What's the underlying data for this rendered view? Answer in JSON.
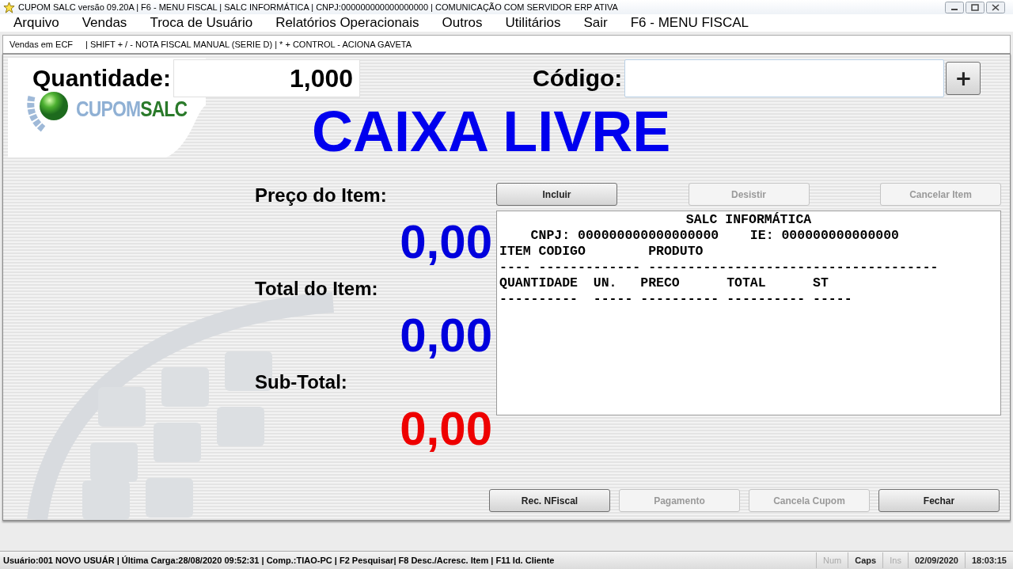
{
  "window": {
    "title": "CUPOM SALC versão 09.20A | F6 - MENU FISCAL | SALC INFORMÁTICA | CNPJ:000000000000000000 | COMUNICAÇÃO COM SERVIDOR ERP ATIVA"
  },
  "menu": [
    "Arquivo",
    "Vendas",
    "Troca de Usuário",
    "Relatórios Operacionais",
    "Outros",
    "Utilitários",
    "Sair",
    "F6 - MENU FISCAL"
  ],
  "tab": {
    "label": "Vendas em ECF",
    "selected": true
  },
  "shortcuts": "| SHIFT + / - NOTA FISCAL MANUAL (SERIE D) | * + CONTROL - ACIONA GAVETA",
  "quantity": {
    "label": "Quantidade:",
    "value": "1,000"
  },
  "code": {
    "label": "Código:",
    "button": "+"
  },
  "logo": {
    "left": "CUPOM",
    "right": "SALC"
  },
  "status_caption": "CAIXA LIVRE",
  "totals": [
    {
      "label": "Preço do Item:",
      "value": "0,00",
      "color": "#0000dd"
    },
    {
      "label": "Total do Item:",
      "value": "0,00",
      "color": "#0000dd"
    },
    {
      "label": "Sub-Total:",
      "value": "0,00",
      "color": "#ee0000"
    }
  ],
  "item_buttons": [
    {
      "label": "Incluir",
      "disabled": false
    },
    {
      "label": "Desistir",
      "disabled": true
    },
    {
      "label": "Cancelar Item",
      "disabled": true
    }
  ],
  "receipt": {
    "lines": [
      "SALC INFORMÁTICA",
      "    CNPJ: 000000000000000000    IE: 000000000000000",
      "ITEM CODIGO        PRODUTO",
      "---- ------------- -------------------------------------",
      "QUANTIDADE  UN.   PRECO      TOTAL      ST",
      "----------  ----- ---------- ---------- -----"
    ]
  },
  "footer_buttons": [
    {
      "label": "Rec. NFiscal",
      "disabled": false
    },
    {
      "label": "Pagamento",
      "disabled": true
    },
    {
      "label": "Cancela Cupom",
      "disabled": true
    },
    {
      "label": "Fechar",
      "disabled": false
    }
  ],
  "status_bar": {
    "text": "Usuário:001 NOVO USUÁR | Última Carga:28/08/2020 09:52:31 | Comp.:TIAO-PC | F2 Pesquisar| F8 Desc./Acresc. Item | F11 Id. Cliente",
    "indicators": [
      {
        "label": "Num",
        "on": false
      },
      {
        "label": "Caps",
        "on": true
      },
      {
        "label": "Ins",
        "on": false
      }
    ],
    "date": "02/09/2020",
    "time": "18:03:15"
  }
}
